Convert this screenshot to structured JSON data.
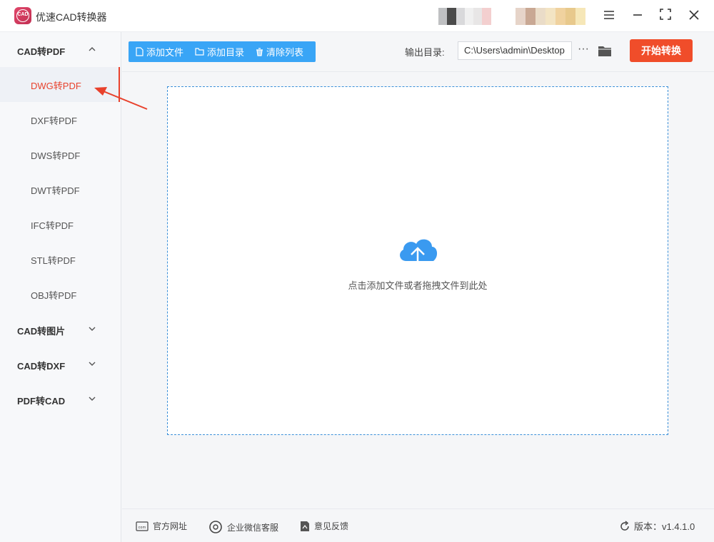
{
  "app": {
    "title": "优速CAD转换器",
    "logo_text": "CAD"
  },
  "sidebar": {
    "groups": [
      {
        "label": "CAD转PDF",
        "expanded": true
      },
      {
        "label": "CAD转图片",
        "expanded": false
      },
      {
        "label": "CAD转DXF",
        "expanded": false
      },
      {
        "label": "PDF转CAD",
        "expanded": false
      }
    ],
    "items": [
      {
        "label": "DWG转PDF",
        "active": true
      },
      {
        "label": "DXF转PDF"
      },
      {
        "label": "DWS转PDF"
      },
      {
        "label": "DWT转PDF"
      },
      {
        "label": "IFC转PDF"
      },
      {
        "label": "STL转PDF"
      },
      {
        "label": "OBJ转PDF"
      }
    ]
  },
  "toolbar": {
    "add_file": "添加文件",
    "add_folder": "添加目录",
    "clear_list": "清除列表",
    "output_label": "输出目录:",
    "output_path": "C:\\Users\\admin\\Desktop",
    "more": "···",
    "start": "开始转换"
  },
  "dropzone": {
    "hint": "点击添加文件或者拖拽文件到此处"
  },
  "footer": {
    "website": "官方网址",
    "wechat": "企业微信客服",
    "feedback": "意见反馈",
    "version": "版本：v1.4.1.0"
  },
  "colors": {
    "accent_blue": "#39a5f6",
    "accent_red": "#f04d2a",
    "active_text": "#e8412c",
    "cloud": "#3a9af0"
  }
}
